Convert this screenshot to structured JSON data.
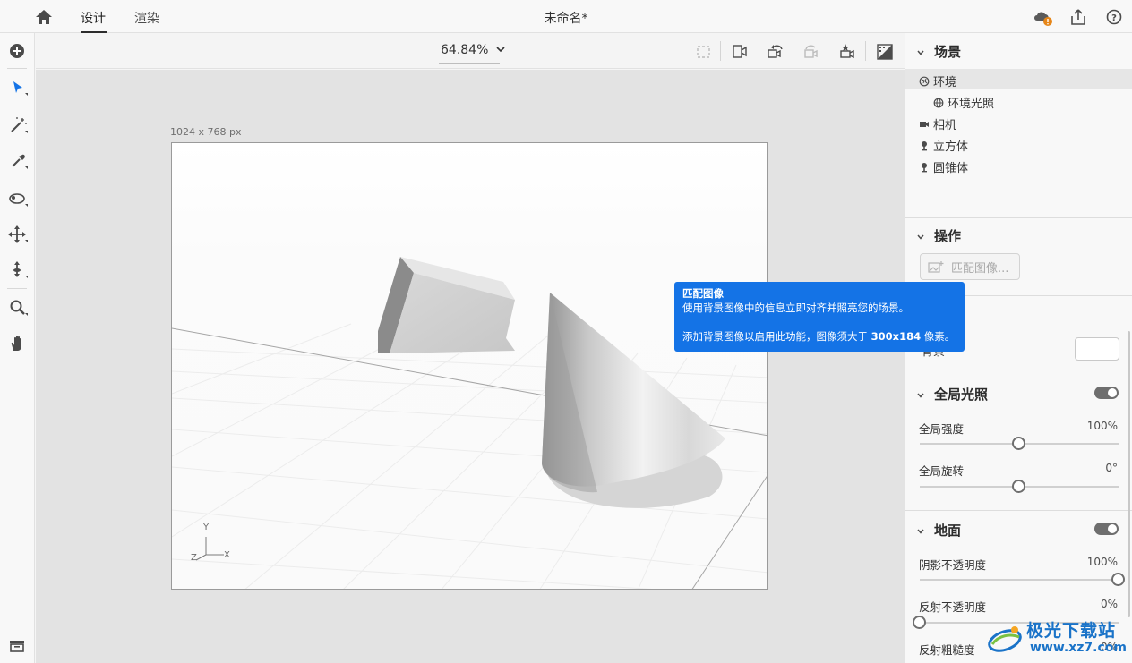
{
  "topbar": {
    "tabs": [
      {
        "label": "设计",
        "active": true
      },
      {
        "label": "渲染",
        "active": false
      }
    ],
    "document_title": "未命名*",
    "icons": [
      "home-icon",
      "cloud-sync-warning-icon",
      "share-icon",
      "help-icon"
    ]
  },
  "left_toolbar": {
    "tools": [
      "add-icon",
      "select-icon",
      "magic-wand-icon",
      "eyedropper-icon",
      "orbit-icon",
      "pan-move-icon",
      "dolly-icon",
      "zoom-icon",
      "hand-icon",
      "panel-icon"
    ]
  },
  "canvas_toolbar": {
    "zoom": "64.84%",
    "icons": [
      "frame-icon",
      "camera-fit-icon",
      "undo-camera-icon",
      "redo-camera-icon",
      "camera-bookmark-icon",
      "preview-render-icon"
    ]
  },
  "canvas": {
    "size_label": "1024 x 768 px",
    "axis_labels": {
      "y": "Y",
      "x": "X",
      "z": "Z"
    }
  },
  "tooltip": {
    "title": "匹配图像",
    "line1": "使用背景图像中的信息立即对齐并照亮您的场景。",
    "line2_prefix": "添加背景图像以启用此功能，图像须大于 ",
    "line2_bold": "300x184",
    "line2_suffix": " 像素。"
  },
  "right_panel": {
    "scene": {
      "header": "场景",
      "items": [
        {
          "label": "环境",
          "icon": "globe-icon",
          "selected": true
        },
        {
          "label": "环境光照",
          "icon": "globe-icon",
          "selected": false
        },
        {
          "label": "相机",
          "icon": "camera-icon",
          "selected": false
        },
        {
          "label": "立方体",
          "icon": "model-icon",
          "selected": false
        },
        {
          "label": "圆锥体",
          "icon": "model-icon",
          "selected": false
        }
      ]
    },
    "actions": {
      "header": "操作",
      "match_image_button": "匹配图像..."
    },
    "background_label": "背景",
    "global_lighting": {
      "header": "全局光照",
      "enabled": true,
      "intensity_label": "全局强度",
      "intensity_value": "100%",
      "intensity_fraction": 0.5,
      "rotation_label": "全局旋转",
      "rotation_value": "0°",
      "rotation_fraction": 0.5
    },
    "ground": {
      "header": "地面",
      "enabled": true,
      "shadow_label": "阴影不透明度",
      "shadow_value": "100%",
      "shadow_fraction": 1.0,
      "reflection_label": "反射不透明度",
      "reflection_value": "0%",
      "reflection_fraction": 0.0,
      "roughness_label": "反射粗糙度",
      "roughness_value": "0%"
    }
  },
  "watermark": {
    "text": "极光下载站",
    "url": "www.xz7.com"
  }
}
